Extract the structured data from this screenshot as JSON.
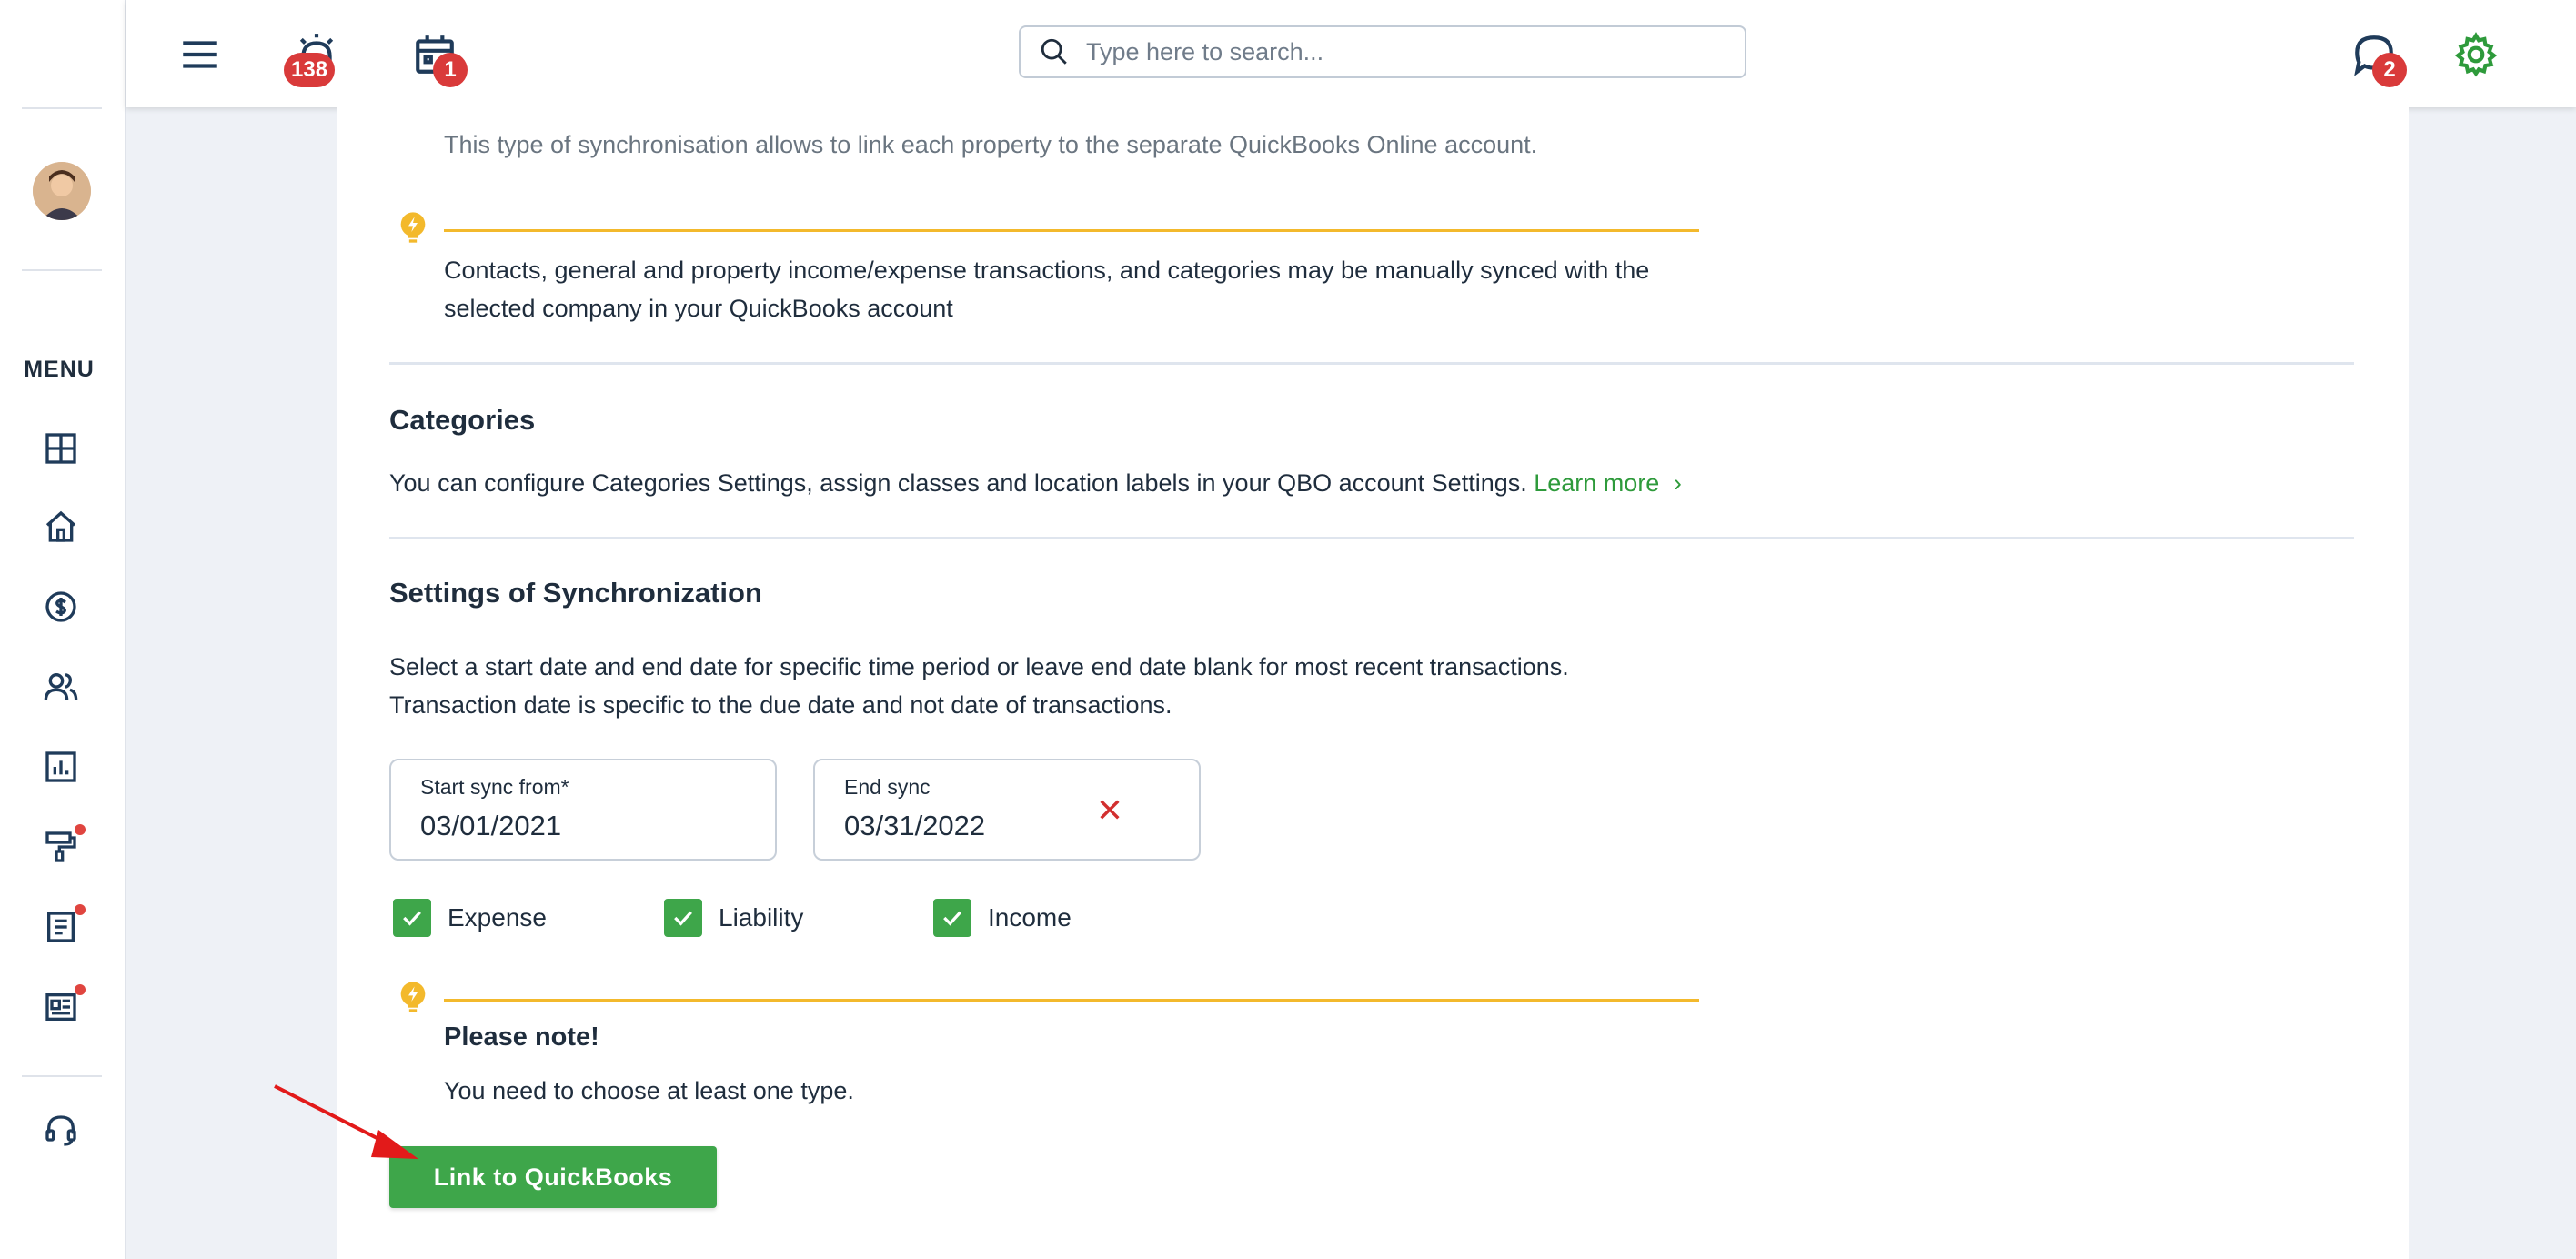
{
  "sidebar": {
    "menu_label": "MENU"
  },
  "topbar": {
    "alerts_count": "138",
    "calendar_count": "1",
    "messages_count": "2",
    "search_placeholder": "Type here to search..."
  },
  "sync_section": {
    "description": "This type of synchronisation allows to link each property to the separate QuickBooks Online account.",
    "tip_line1": "Contacts, general and property income/expense transactions, and categories may be manually synced with the",
    "tip_line2": "selected company in your QuickBooks account"
  },
  "categories": {
    "title": "Categories",
    "text": "You can configure Categories Settings, assign classes and location labels in your QBO account Settings.",
    "learn_more": "Learn more"
  },
  "settings_sync": {
    "title": "Settings of Synchronization",
    "line1": "Select a start date and end date for specific time period or leave end date blank for most recent transactions.",
    "line2": "Transaction date is specific to the due date and not date of transactions.",
    "start_label": "Start sync from*",
    "start_value": "03/01/2021",
    "end_label": "End sync",
    "end_value": "03/31/2022",
    "checkboxes": [
      {
        "label": "Expense",
        "checked": true
      },
      {
        "label": "Liability",
        "checked": true
      },
      {
        "label": "Income",
        "checked": true
      }
    ],
    "note_title": "Please note!",
    "note_text": "You need to choose at least one type.",
    "link_button": "Link to QuickBooks"
  },
  "colors": {
    "accent_green": "#3ea64a",
    "badge_red": "#d93a3a",
    "tip_yellow": "#f3b92c",
    "nav_icon": "#1f3b5a"
  }
}
